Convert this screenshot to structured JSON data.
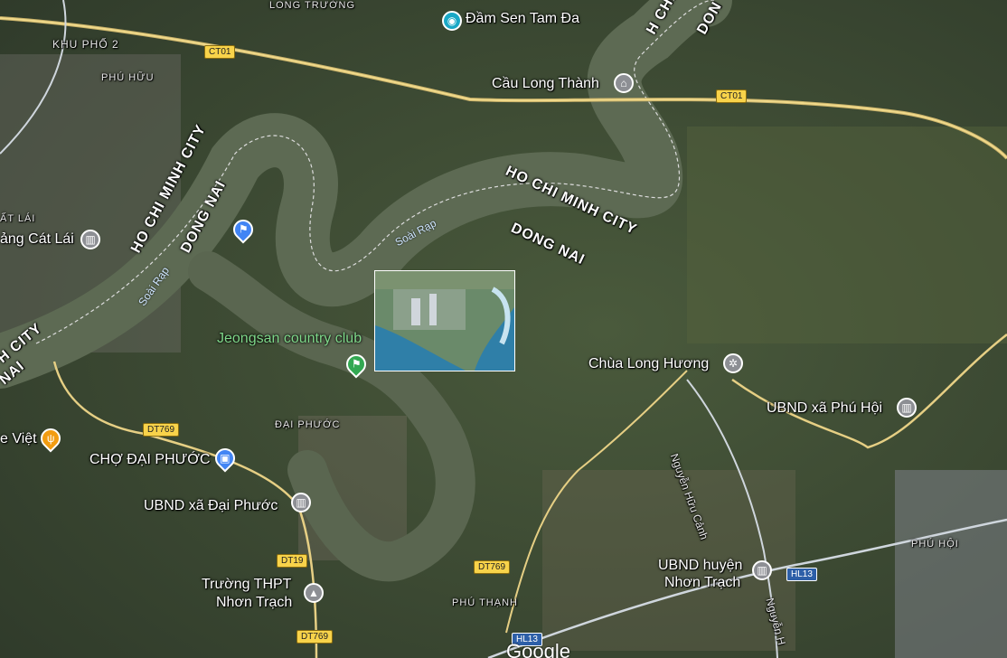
{
  "map": {
    "provider_logo": "Google",
    "admin_boundaries": [
      {
        "text": "HO CHI MINH CITY",
        "id": "hcm-center"
      },
      {
        "text": "DONG NAI",
        "id": "dn-center"
      },
      {
        "text": "HO CHI MINH CITY",
        "id": "hcm-west"
      },
      {
        "text": "DONG NAI",
        "id": "dn-west"
      },
      {
        "text": "H CHI",
        "id": "hcm-top"
      },
      {
        "text": "DON",
        "id": "dn-top"
      },
      {
        "text": "H CITY",
        "id": "hcm-left"
      },
      {
        "text": "NAI",
        "id": "dn-left"
      }
    ],
    "water_labels": [
      "Soài Rạp",
      "Soài Rạp"
    ],
    "area_labels": [
      "LONG TRƯỜNG",
      "KHU PHỐ 2",
      "PHÚ HỮU",
      "ĐẠI PHƯỚC",
      "PHÚ THẠNH",
      "PHÚ HỘI",
      "ẤT LÁI"
    ],
    "places": [
      {
        "name": "Đầm Sen Tam Đa",
        "icon": "camera-icon",
        "color": "#1aa8c6"
      },
      {
        "name": "Cầu Long Thành",
        "icon": "bridge-icon",
        "color": "#8d8f94"
      },
      {
        "name": "Chùa Long Hương",
        "icon": "temple-icon",
        "color": "#8d8f94"
      },
      {
        "name": "UBND xã Phú Hội",
        "icon": "government-icon",
        "color": "#8d8f94"
      },
      {
        "name": "Jeongsan country club",
        "icon": "golf-icon",
        "color": "#33a852"
      },
      {
        "name": "CHỢ ĐẠI PHƯỚC",
        "icon": "shopping-icon",
        "color": "#4285f4"
      },
      {
        "name": "UBND xã Đại Phước",
        "icon": "government-icon",
        "color": "#8d8f94"
      },
      {
        "name": "Trường THPT Nhơn Trạch",
        "line1": "Trường THPT",
        "line2": "Nhơn Trạch",
        "icon": "school-icon",
        "color": "#8d8f94"
      },
      {
        "name": "UBND huyện Nhơn Trạch",
        "line1": "UBND huyện",
        "line2": "Nhơn Trạch",
        "icon": "government-icon",
        "color": "#8d8f94"
      },
      {
        "name": "ảng Cát Lái",
        "icon": "government-icon",
        "color": "#8d8f94"
      },
      {
        "name": "e Việt",
        "icon": "restaurant-icon",
        "color": "#f29c11"
      }
    ],
    "roads": [
      {
        "label": "CT01",
        "id": "ct01-a"
      },
      {
        "label": "CT01",
        "id": "ct01-b"
      },
      {
        "label": "DT769",
        "id": "dt769-a"
      },
      {
        "label": "DT19",
        "id": "dt19"
      },
      {
        "label": "DT769",
        "id": "dt769-b"
      },
      {
        "label": "DT769",
        "id": "dt769-c"
      },
      {
        "label": "HL13",
        "id": "hl13-a"
      },
      {
        "label": "HL13",
        "id": "hl13-b"
      }
    ],
    "street_names": [
      "Nguyễn Hữu Cảnh",
      "Nguyễn H"
    ]
  }
}
